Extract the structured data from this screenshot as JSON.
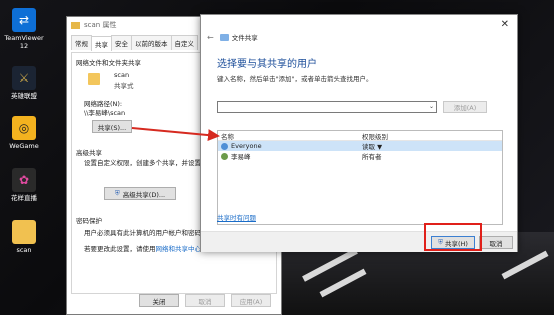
{
  "desktop": {
    "icons": [
      {
        "label": "TeamViewer\n12",
        "icon": "teamviewer-icon",
        "color": "#0e6fd6"
      },
      {
        "label": "英雄联盟",
        "icon": "league-icon",
        "color": "#1b2433"
      },
      {
        "label": "WeGame",
        "icon": "wegame-icon",
        "color": "#f3b21f"
      },
      {
        "label": "花样直播",
        "icon": "huayang-icon",
        "color": "#c72a80"
      },
      {
        "label": "scan",
        "icon": "folder-icon",
        "color": "#f1c150"
      }
    ]
  },
  "props": {
    "title": "scan 属性",
    "tabs": [
      "常规",
      "共享",
      "安全",
      "以前的版本",
      "自定义"
    ],
    "section1": "网络文件和文件夹共享",
    "folder_name": "scan",
    "folder_status": "共享式",
    "net_path_label": "网络路径(N):",
    "net_path": "\\\\李易峰\\scan",
    "share_btn": "共享(S)...",
    "section2": "高级共享",
    "adv_desc": "设置自定义权限，创建多个共享，并设置其他高级共享选项。",
    "adv_btn": "高级共享(D)...",
    "section3": "密码保护",
    "pwd_desc1": "用户必须具有此计算机的用户帐户和密码，",
    "pwd_desc2": "若要更改此设置，请使用",
    "pwd_link": "网络和共享中心",
    "ok_btn": "关闭",
    "cancel_btn": "取消",
    "apply_btn": "应用(A)"
  },
  "share": {
    "nav_title": "文件共享",
    "heading": "选择要与其共享的用户",
    "subtitle": "键入名称，然后单击\"添加\"，或者单击箭头查找用户。",
    "add_btn": "添加(A)",
    "col_name": "名称",
    "col_perm": "权限级别",
    "users": [
      {
        "name": "Everyone",
        "perm": "读取 ▼",
        "selected": true,
        "color": "#4f8fd6"
      },
      {
        "name": "李易峰",
        "perm": "所有者",
        "selected": false,
        "color": "#6c9b4b"
      }
    ],
    "trouble_link": "共享时有问题",
    "share_btn": "共享(H)",
    "cancel_btn": "取消"
  }
}
